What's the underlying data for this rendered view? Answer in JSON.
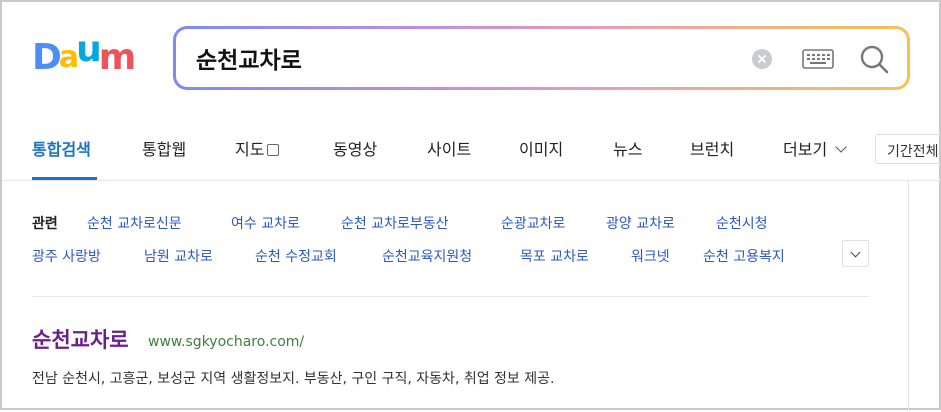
{
  "logo": {
    "letters": [
      "D",
      "a",
      "u",
      "m"
    ],
    "colors": [
      "#4d8ef5",
      "#ffbc00",
      "#00a9e0",
      "#f0525c"
    ]
  },
  "search": {
    "query": "순천교차로"
  },
  "tabs": [
    {
      "label": "통합검색"
    },
    {
      "label": "통합웹"
    },
    {
      "label": "지도"
    },
    {
      "label": "동영상"
    },
    {
      "label": "사이트"
    },
    {
      "label": "이미지"
    },
    {
      "label": "뉴스"
    },
    {
      "label": "브런치"
    },
    {
      "label": "더보기"
    }
  ],
  "period_label": "기간전체",
  "related": {
    "label": "관련",
    "row1": [
      "순천 교차로신문",
      "여수 교차로",
      "순천 교차로부동산",
      "순광교차로",
      "광양 교차로",
      "순천시청"
    ],
    "row2": [
      "광주 사랑방",
      "남원 교차로",
      "순천 수정교회",
      "순천교육지원청",
      "목포 교차로",
      "워크넷",
      "순천 고용복지"
    ]
  },
  "result": {
    "title": "순천교차로",
    "url": "www.sgkyocharo.com/",
    "description": "전남 순천시, 고흥군, 보성군 지역 생활정보지. 부동산, 구인 구직, 자동차, 취업 정보 제공."
  },
  "colors": {
    "accent": "#1a73c9",
    "link": "#2b57c7",
    "visited_title": "#6a1f8f",
    "url": "#3f7f3f"
  }
}
